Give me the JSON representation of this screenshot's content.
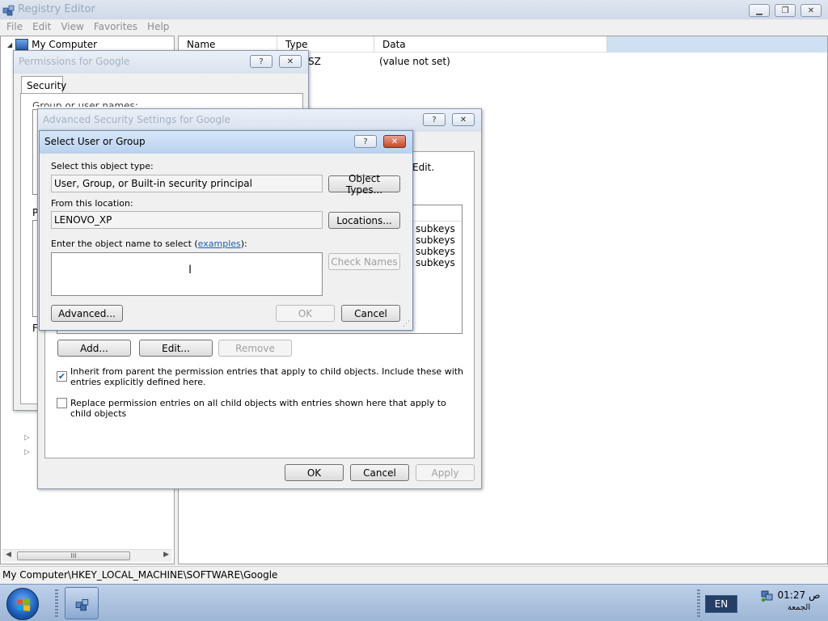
{
  "regedit": {
    "title": "Registry Editor",
    "menu": [
      "File",
      "Edit",
      "View",
      "Favorites",
      "Help"
    ],
    "tree_root": "My Computer",
    "columns": {
      "name": "Name",
      "type": "Type",
      "data": "Data"
    },
    "row": {
      "type_partial": "SZ",
      "data": "(value not set)"
    },
    "scroll_grip": "III",
    "status_path": "My Computer\\HKEY_LOCAL_MACHINE\\SOFTWARE\\Google"
  },
  "permissions_dialog": {
    "title": "Permissions for Google",
    "tab": "Security",
    "group_label_partial": "Group or user names:",
    "p_label_partial": "P",
    "f_label_partial": "F"
  },
  "advanced_dialog": {
    "title": "Advanced Security Settings for Google",
    "edit_partial": "Edit.",
    "apply_to": [
      "subkeys",
      "subkeys",
      "subkeys",
      "subkeys"
    ],
    "add_label": "Add...",
    "edit_label": "Edit...",
    "remove_label": "Remove",
    "inherit_text": "Inherit from parent the permission entries that apply to child objects. Include these with entries explicitly defined here.",
    "inherit_checked": true,
    "replace_text": "Replace permission entries on all child objects with entries shown here that apply to child objects",
    "replace_checked": false,
    "ok_label": "OK",
    "cancel_label": "Cancel",
    "apply_label": "Apply"
  },
  "select_dialog": {
    "title": "Select User or Group",
    "object_type_label": "Select this object type:",
    "object_type_value": "User, Group, or Built-in security principal",
    "object_types_button": "Object Types...",
    "location_label": "From this location:",
    "location_value": "LENOVO_XP",
    "locations_button": "Locations...",
    "object_name_label": "Enter the object name to select (",
    "examples_link": "examples",
    "object_name_label_end": "):",
    "object_name_value": "",
    "check_names_button": "Check Names",
    "advanced_button": "Advanced...",
    "ok_button": "OK",
    "cancel_button": "Cancel"
  },
  "taskbar": {
    "language": "EN",
    "time": "01:27 ص",
    "day": "الجمعة"
  },
  "colors": {
    "link": "#1a5fb4",
    "active_title": "#c4d8f0",
    "taskbar": "#a9c0de"
  }
}
